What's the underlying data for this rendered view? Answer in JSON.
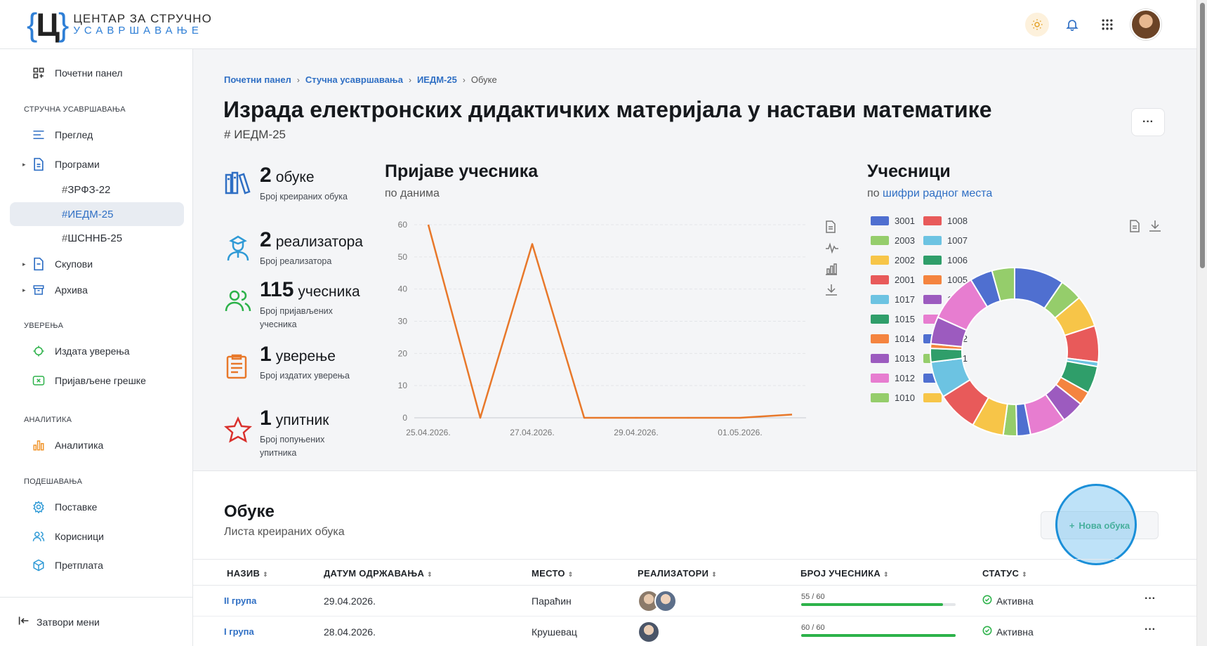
{
  "header": {
    "logo_mark": "Ц",
    "logo_line1": "ЦЕНТАР ЗА СТРУЧНО",
    "logo_line2": "УСАВРШАВАЊЕ"
  },
  "sidebar": {
    "dashboard": "Почетни панел",
    "section_training": "СТРУЧНА УСАВРШАВАЊА",
    "overview": "Преглед",
    "programs": "Програми",
    "program_items": [
      "ЗРФЗ-22",
      "ИЕДМ-25",
      "ШСННБ-25"
    ],
    "sets": "Скупови",
    "archive": "Архива",
    "section_certs": "УВЕРЕЊА",
    "issued_certs": "Издата уверења",
    "reported_errors": "Пријављене грешке",
    "section_analytics": "АНАЛИТИКА",
    "analytics": "Аналитика",
    "section_settings": "ПОДЕШАВАЊА",
    "settings": "Поставке",
    "users": "Корисници",
    "subscription": "Претплата",
    "close_menu": "Затвори мени"
  },
  "breadcrumb": {
    "items": [
      "Почетни панел",
      "Стучна усавршавања",
      "ИЕДМ-25"
    ],
    "current": "Обуке"
  },
  "page": {
    "title": "Израда електронских дидактичких материјала у настави математике",
    "code": "ИЕДМ-25",
    "more": "···"
  },
  "stats": [
    {
      "num": "2",
      "unit": "обуке",
      "desc": "Број креираних обука",
      "icon": "books-icon"
    },
    {
      "num": "2",
      "unit": "реализатора",
      "desc": "Број реализатора",
      "icon": "instructor-icon"
    },
    {
      "num": "115",
      "unit": "учесника",
      "desc": "Број пријављених учесника",
      "icon": "users-icon"
    },
    {
      "num": "1",
      "unit": "уверење",
      "desc": "Број издатих уверења",
      "icon": "certificate-icon"
    },
    {
      "num": "1",
      "unit": "упитник",
      "desc": "Број попуњених упитника",
      "icon": "star-icon"
    }
  ],
  "line_chart": {
    "title": "Пријаве учесника",
    "subtitle": "по данима"
  },
  "donut_chart": {
    "title": "Учесници",
    "subtitle_prefix": "по",
    "subtitle_link": "шифри радног места"
  },
  "chart_data": [
    {
      "type": "line",
      "x": [
        "25.04.2026.",
        "26.04.2026.",
        "27.04.2026.",
        "28.04.2026.",
        "29.04.2026.",
        "30.04.2026.",
        "01.05.2026.",
        "02.05.2026."
      ],
      "x_tick_labels": [
        "25.04.2026.",
        "27.04.2026.",
        "29.04.2026.",
        "01.05.2026."
      ],
      "series": [
        {
          "values": [
            60,
            0,
            54,
            0,
            0,
            0,
            0,
            1
          ]
        }
      ],
      "ylim": [
        0,
        60
      ],
      "y_ticks": [
        0,
        10,
        20,
        30,
        40,
        50,
        60
      ],
      "color": "#e8782a",
      "grid": true
    },
    {
      "type": "pie",
      "donut": true,
      "legend_position": "left",
      "legend": [
        {
          "label": "3001",
          "color": "#4f6fd0"
        },
        {
          "label": "1008",
          "color": "#e85a5a"
        },
        {
          "label": "2003",
          "color": "#95cd6b"
        },
        {
          "label": "1007",
          "color": "#6cc3e2"
        },
        {
          "label": "2002",
          "color": "#f7c548"
        },
        {
          "label": "1006",
          "color": "#2f9e6a"
        },
        {
          "label": "2001",
          "color": "#e85a5a"
        },
        {
          "label": "1005",
          "color": "#f4843f"
        },
        {
          "label": "1017",
          "color": "#6cc3e2"
        },
        {
          "label": "1004",
          "color": "#9c5bbf"
        },
        {
          "label": "1015",
          "color": "#2f9e6a"
        },
        {
          "label": "1003",
          "color": "#e77dd0"
        },
        {
          "label": "1014",
          "color": "#f4843f"
        },
        {
          "label": "1002",
          "color": "#4f6fd0"
        },
        {
          "label": "1013",
          "color": "#9c5bbf"
        },
        {
          "label": "1001",
          "color": "#95cd6b"
        },
        {
          "label": "1012",
          "color": "#e77dd0"
        },
        {
          "label": "1011",
          "color": "#4f6fd0"
        },
        {
          "label": "1010",
          "color": "#95cd6b"
        },
        {
          "label": "1009",
          "color": "#f7c548"
        }
      ],
      "slices": [
        {
          "value": 11,
          "color": "#4f6fd0"
        },
        {
          "value": 5,
          "color": "#95cd6b"
        },
        {
          "value": 7,
          "color": "#f7c548"
        },
        {
          "value": 8,
          "color": "#e85a5a"
        },
        {
          "value": 1,
          "color": "#6cc3e2"
        },
        {
          "value": 6,
          "color": "#2f9e6a"
        },
        {
          "value": 3,
          "color": "#f4843f"
        },
        {
          "value": 5,
          "color": "#9c5bbf"
        },
        {
          "value": 8,
          "color": "#e77dd0"
        },
        {
          "value": 3,
          "color": "#4f6fd0"
        },
        {
          "value": 3,
          "color": "#95cd6b"
        },
        {
          "value": 7,
          "color": "#f7c548"
        },
        {
          "value": 9,
          "color": "#e85a5a"
        },
        {
          "value": 8,
          "color": "#6cc3e2"
        },
        {
          "value": 3,
          "color": "#2f9e6a"
        },
        {
          "value": 1,
          "color": "#f4843f"
        },
        {
          "value": 6,
          "color": "#9c5bbf"
        },
        {
          "value": 11,
          "color": "#e77dd0"
        },
        {
          "value": 5,
          "color": "#4f6fd0"
        },
        {
          "value": 5,
          "color": "#95cd6b"
        }
      ]
    }
  ],
  "trainings": {
    "title": "Обуке",
    "subtitle": "Листа креираних обука",
    "new_button": "Нова обука",
    "columns": [
      "НАЗИВ",
      "ДАТУМ ОДРЖАВАЊА",
      "МЕСТО",
      "РЕАЛИЗАТОРИ",
      "БРОЈ УЧЕСНИКА",
      "СТАТУС"
    ],
    "rows": [
      {
        "name": "II група",
        "date": "29.04.2026.",
        "place": "Параћин",
        "avatars": 2,
        "participants": "55 / 60",
        "fill": 0.917,
        "status": "Активна",
        "more": "···"
      },
      {
        "name": "I група",
        "date": "28.04.2026.",
        "place": "Крушевац",
        "avatars": 1,
        "participants": "60 / 60",
        "fill": 1.0,
        "status": "Активна",
        "more": "···"
      }
    ]
  },
  "colors": {
    "accent": "#2f6fc4",
    "success": "#27a35a",
    "line": "#e8782a"
  }
}
